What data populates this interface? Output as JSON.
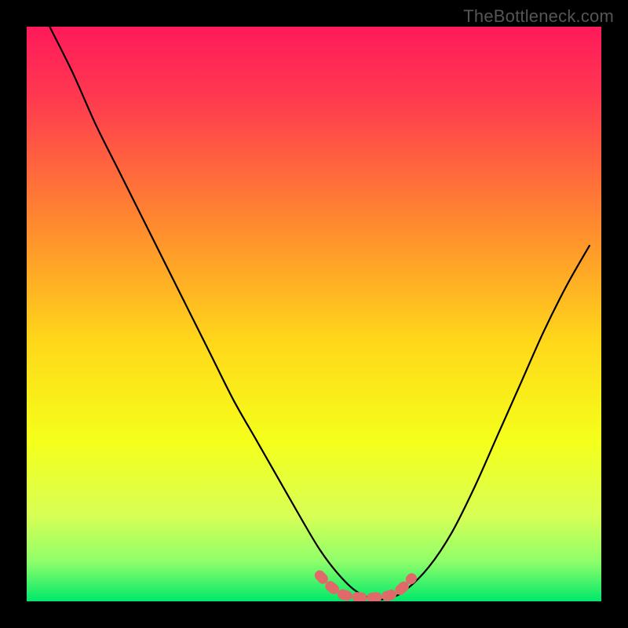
{
  "watermark": "TheBottleneck.com",
  "chart_data": {
    "type": "line",
    "title": "",
    "xlabel": "",
    "ylabel": "",
    "xlim": [
      0,
      100
    ],
    "ylim": [
      0,
      100
    ],
    "gradient_stops": [
      {
        "offset": 0,
        "color": "#ff1a5a"
      },
      {
        "offset": 0.12,
        "color": "#ff3850"
      },
      {
        "offset": 0.35,
        "color": "#ff8c2e"
      },
      {
        "offset": 0.55,
        "color": "#ffd81a"
      },
      {
        "offset": 0.72,
        "color": "#f5ff1a"
      },
      {
        "offset": 0.85,
        "color": "#d8ff55"
      },
      {
        "offset": 0.93,
        "color": "#90ff6a"
      },
      {
        "offset": 1.0,
        "color": "#00e86a"
      }
    ],
    "series": [
      {
        "name": "bottleneck-curve",
        "color": "#000000",
        "x": [
          4,
          8,
          12,
          16,
          20,
          24,
          28,
          32,
          36,
          40,
          44,
          48,
          51,
          54,
          57,
          60,
          63,
          66,
          70,
          74,
          78,
          82,
          86,
          90,
          94,
          98
        ],
        "y": [
          100,
          92,
          83,
          75,
          67,
          59,
          51,
          43,
          35,
          28,
          21,
          14,
          9,
          5,
          2,
          0.5,
          0.5,
          2,
          6,
          12,
          20,
          29,
          38,
          47,
          55,
          62
        ]
      },
      {
        "name": "optimal-region",
        "color": "#e06a6a",
        "x": [
          51,
          53,
          55,
          57,
          59,
          61,
          63,
          65,
          67
        ],
        "y": [
          4.5,
          2.5,
          1.2,
          0.8,
          0.6,
          0.7,
          1.0,
          2.0,
          4.0
        ]
      }
    ]
  }
}
